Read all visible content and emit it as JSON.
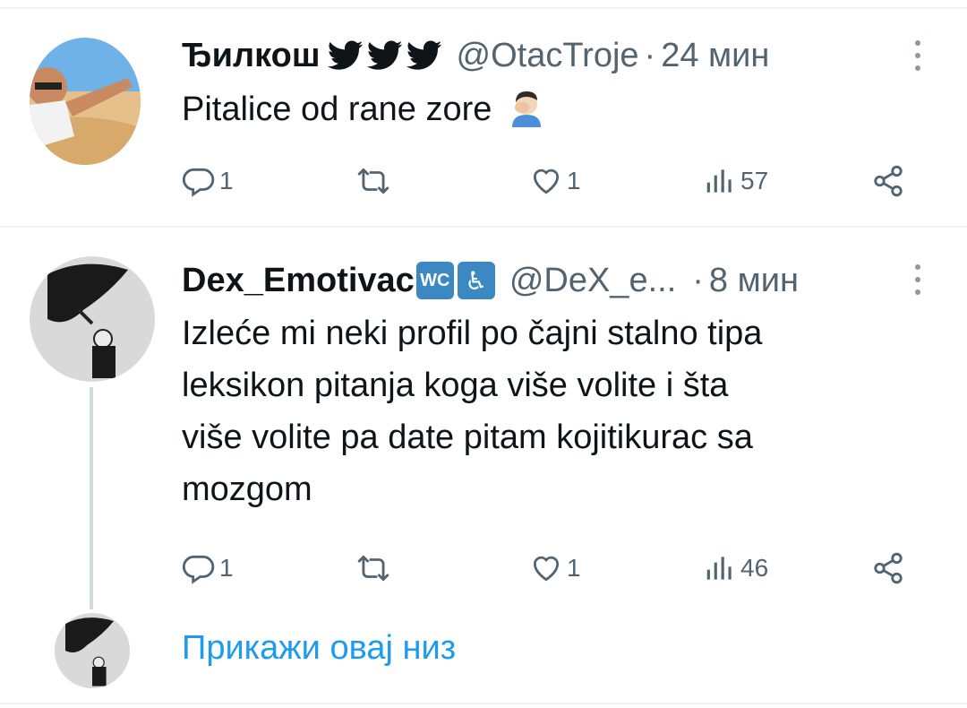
{
  "tweets": [
    {
      "name": "Ђилкош",
      "handle": "@OtacTroje",
      "separator": "·",
      "time": "24 мин",
      "text": "Pitalice od rane zore",
      "name_emojis": [
        "bird-icon",
        "bird-icon",
        "bird-icon"
      ],
      "text_emoji": "facepalm-emoji",
      "stats": {
        "replies": "1",
        "retweets": "",
        "likes": "1",
        "views": "57"
      }
    },
    {
      "name": "Dex_Emotivac",
      "handle": "@DeX_e...",
      "separator": "·",
      "time": "8 мин",
      "badges": [
        "WC",
        "♿"
      ],
      "text_lines": [
        "Izleće mi neki profil po čajni stalno tipa",
        "leksikon pitanja koga više volite i šta",
        "više volite pa date pitam kojitikurac sa",
        "mozgom"
      ],
      "stats": {
        "replies": "1",
        "retweets": "",
        "likes": "1",
        "views": "46"
      }
    }
  ],
  "show_thread": "Прикажи овај низ",
  "colors": {
    "accent": "#1d9bf0",
    "secondary_text": "#536471",
    "badge_blue": "#3b88c3",
    "divider": "#eff3f4"
  }
}
